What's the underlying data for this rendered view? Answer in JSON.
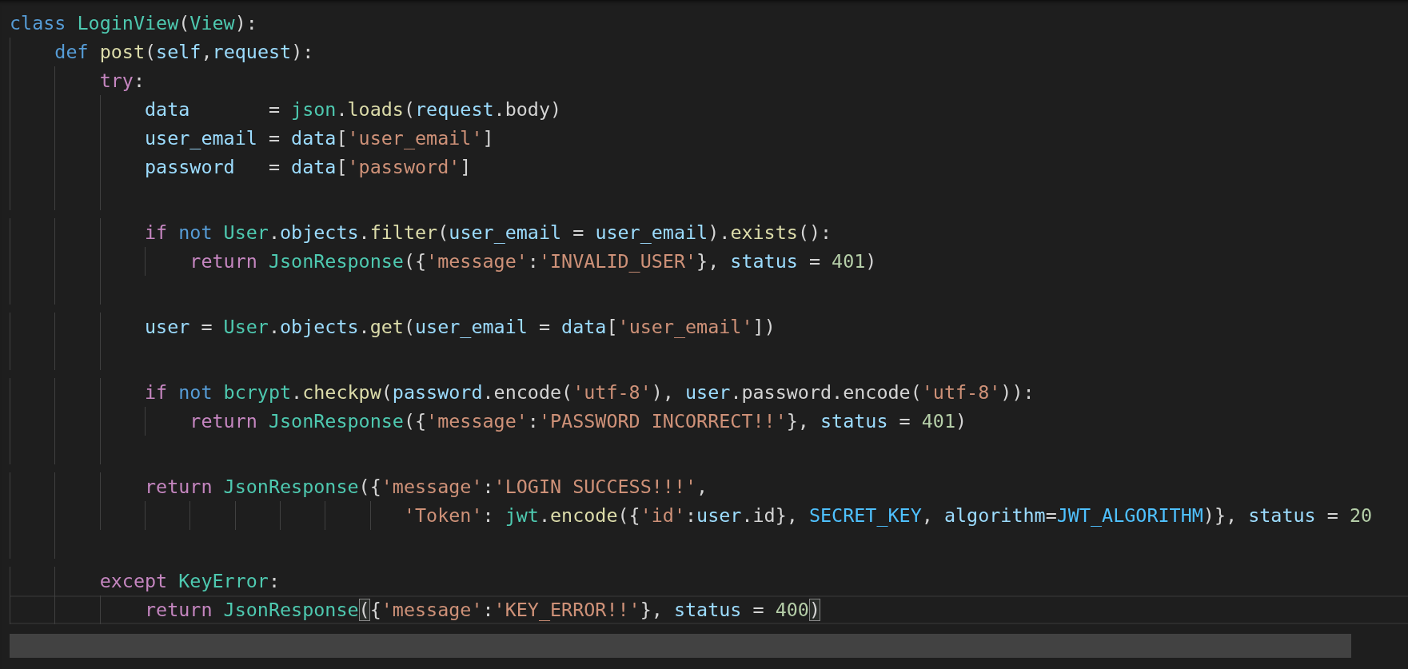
{
  "editor": {
    "lines": [
      {
        "kind": "code",
        "active": false,
        "tokens": [
          {
            "kind": "keyword",
            "text": "class "
          },
          {
            "kind": "type",
            "text": "LoginView"
          },
          {
            "kind": "plain",
            "text": "("
          },
          {
            "kind": "type",
            "text": "View"
          },
          {
            "kind": "plain",
            "text": "):"
          }
        ]
      },
      {
        "kind": "code",
        "active": false,
        "tokens": [
          {
            "kind": "keyword",
            "text": "    def "
          },
          {
            "kind": "function",
            "text": "post"
          },
          {
            "kind": "plain",
            "text": "("
          },
          {
            "kind": "variable",
            "text": "self"
          },
          {
            "kind": "plain",
            "text": ","
          },
          {
            "kind": "variable",
            "text": "request"
          },
          {
            "kind": "plain",
            "text": "):"
          }
        ]
      },
      {
        "kind": "code",
        "active": false,
        "tokens": [
          {
            "kind": "control",
            "text": "        try"
          },
          {
            "kind": "plain",
            "text": ":"
          }
        ]
      },
      {
        "kind": "code",
        "active": false,
        "tokens": [
          {
            "kind": "variable",
            "text": "            data"
          },
          {
            "kind": "plain",
            "text": "       = "
          },
          {
            "kind": "type",
            "text": "json"
          },
          {
            "kind": "plain",
            "text": "."
          },
          {
            "kind": "function",
            "text": "loads"
          },
          {
            "kind": "plain",
            "text": "("
          },
          {
            "kind": "variable",
            "text": "request"
          },
          {
            "kind": "plain",
            "text": ".body)"
          }
        ]
      },
      {
        "kind": "code",
        "active": false,
        "tokens": [
          {
            "kind": "variable",
            "text": "            user_email"
          },
          {
            "kind": "plain",
            "text": " = "
          },
          {
            "kind": "variable",
            "text": "data"
          },
          {
            "kind": "plain",
            "text": "["
          },
          {
            "kind": "string",
            "text": "'user_email'"
          },
          {
            "kind": "plain",
            "text": "]"
          }
        ]
      },
      {
        "kind": "code",
        "active": false,
        "tokens": [
          {
            "kind": "variable",
            "text": "            password"
          },
          {
            "kind": "plain",
            "text": "   = "
          },
          {
            "kind": "variable",
            "text": "data"
          },
          {
            "kind": "plain",
            "text": "["
          },
          {
            "kind": "string",
            "text": "'password'"
          },
          {
            "kind": "plain",
            "text": "]"
          }
        ]
      },
      {
        "kind": "blank"
      },
      {
        "kind": "code",
        "active": false,
        "tokens": [
          {
            "kind": "control",
            "text": "            if "
          },
          {
            "kind": "keyword",
            "text": "not "
          },
          {
            "kind": "type",
            "text": "User"
          },
          {
            "kind": "plain",
            "text": "."
          },
          {
            "kind": "variable",
            "text": "objects"
          },
          {
            "kind": "plain",
            "text": "."
          },
          {
            "kind": "function",
            "text": "filter"
          },
          {
            "kind": "plain",
            "text": "("
          },
          {
            "kind": "variable",
            "text": "user_email"
          },
          {
            "kind": "plain",
            "text": " = "
          },
          {
            "kind": "variable",
            "text": "user_email"
          },
          {
            "kind": "plain",
            "text": ")."
          },
          {
            "kind": "function",
            "text": "exists"
          },
          {
            "kind": "plain",
            "text": "():"
          }
        ]
      },
      {
        "kind": "code",
        "active": false,
        "tokens": [
          {
            "kind": "control",
            "text": "                return "
          },
          {
            "kind": "type",
            "text": "JsonResponse"
          },
          {
            "kind": "plain",
            "text": "({"
          },
          {
            "kind": "string",
            "text": "'message'"
          },
          {
            "kind": "plain",
            "text": ":"
          },
          {
            "kind": "string",
            "text": "'INVALID_USER'"
          },
          {
            "kind": "plain",
            "text": "}, "
          },
          {
            "kind": "variable",
            "text": "status"
          },
          {
            "kind": "plain",
            "text": " = "
          },
          {
            "kind": "number",
            "text": "401"
          },
          {
            "kind": "plain",
            "text": ")"
          }
        ]
      },
      {
        "kind": "blank"
      },
      {
        "kind": "code",
        "active": false,
        "tokens": [
          {
            "kind": "variable",
            "text": "            user"
          },
          {
            "kind": "plain",
            "text": " = "
          },
          {
            "kind": "type",
            "text": "User"
          },
          {
            "kind": "plain",
            "text": "."
          },
          {
            "kind": "variable",
            "text": "objects"
          },
          {
            "kind": "plain",
            "text": "."
          },
          {
            "kind": "function",
            "text": "get"
          },
          {
            "kind": "plain",
            "text": "("
          },
          {
            "kind": "variable",
            "text": "user_email"
          },
          {
            "kind": "plain",
            "text": " = "
          },
          {
            "kind": "variable",
            "text": "data"
          },
          {
            "kind": "plain",
            "text": "["
          },
          {
            "kind": "string",
            "text": "'user_email'"
          },
          {
            "kind": "plain",
            "text": "])"
          }
        ]
      },
      {
        "kind": "blank"
      },
      {
        "kind": "code",
        "active": false,
        "tokens": [
          {
            "kind": "control",
            "text": "            if "
          },
          {
            "kind": "keyword",
            "text": "not "
          },
          {
            "kind": "type",
            "text": "bcrypt"
          },
          {
            "kind": "plain",
            "text": "."
          },
          {
            "kind": "function",
            "text": "checkpw"
          },
          {
            "kind": "plain",
            "text": "("
          },
          {
            "kind": "variable",
            "text": "password"
          },
          {
            "kind": "plain",
            "text": ".encode("
          },
          {
            "kind": "string",
            "text": "'utf-8'"
          },
          {
            "kind": "plain",
            "text": "), "
          },
          {
            "kind": "variable",
            "text": "user"
          },
          {
            "kind": "plain",
            "text": ".password.encode("
          },
          {
            "kind": "string",
            "text": "'utf-8'"
          },
          {
            "kind": "plain",
            "text": ")):"
          }
        ]
      },
      {
        "kind": "code",
        "active": false,
        "tokens": [
          {
            "kind": "control",
            "text": "                return "
          },
          {
            "kind": "type",
            "text": "JsonResponse"
          },
          {
            "kind": "plain",
            "text": "({"
          },
          {
            "kind": "string",
            "text": "'message'"
          },
          {
            "kind": "plain",
            "text": ":"
          },
          {
            "kind": "string",
            "text": "'PASSWORD INCORRECT!!'"
          },
          {
            "kind": "plain",
            "text": "}, "
          },
          {
            "kind": "variable",
            "text": "status"
          },
          {
            "kind": "plain",
            "text": " = "
          },
          {
            "kind": "number",
            "text": "401"
          },
          {
            "kind": "plain",
            "text": ")"
          }
        ]
      },
      {
        "kind": "blank"
      },
      {
        "kind": "code",
        "active": false,
        "tokens": [
          {
            "kind": "control",
            "text": "            return "
          },
          {
            "kind": "type",
            "text": "JsonResponse"
          },
          {
            "kind": "plain",
            "text": "({"
          },
          {
            "kind": "string",
            "text": "'message'"
          },
          {
            "kind": "plain",
            "text": ":"
          },
          {
            "kind": "string",
            "text": "'LOGIN SUCCESS!!!'"
          },
          {
            "kind": "plain",
            "text": ","
          }
        ]
      },
      {
        "kind": "code",
        "active": false,
        "tokens": [
          {
            "kind": "string",
            "text": "                                   'Token'"
          },
          {
            "kind": "plain",
            "text": ": "
          },
          {
            "kind": "type",
            "text": "jwt"
          },
          {
            "kind": "plain",
            "text": "."
          },
          {
            "kind": "function",
            "text": "encode"
          },
          {
            "kind": "plain",
            "text": "({"
          },
          {
            "kind": "string",
            "text": "'id'"
          },
          {
            "kind": "plain",
            "text": ":"
          },
          {
            "kind": "variable",
            "text": "user"
          },
          {
            "kind": "plain",
            "text": ".id}, "
          },
          {
            "kind": "constant",
            "text": "SECRET_KEY"
          },
          {
            "kind": "plain",
            "text": ", "
          },
          {
            "kind": "variable",
            "text": "algorithm"
          },
          {
            "kind": "plain",
            "text": "="
          },
          {
            "kind": "constant",
            "text": "JWT_ALGORITHM"
          },
          {
            "kind": "plain",
            "text": ")}, "
          },
          {
            "kind": "variable",
            "text": "status"
          },
          {
            "kind": "plain",
            "text": " = "
          },
          {
            "kind": "number",
            "text": "20"
          }
        ]
      },
      {
        "kind": "blank"
      },
      {
        "kind": "code",
        "active": false,
        "tokens": [
          {
            "kind": "control",
            "text": "        except "
          },
          {
            "kind": "type",
            "text": "KeyError"
          },
          {
            "kind": "plain",
            "text": ":"
          }
        ]
      },
      {
        "kind": "code",
        "active": true,
        "tokens": [
          {
            "kind": "control",
            "text": "            return "
          },
          {
            "kind": "type",
            "text": "JsonResponse"
          },
          {
            "kind": "bracket",
            "text": "("
          },
          {
            "kind": "plain",
            "text": "{"
          },
          {
            "kind": "string",
            "text": "'message'"
          },
          {
            "kind": "plain",
            "text": ":"
          },
          {
            "kind": "string",
            "text": "'KEY_ERROR!!'"
          },
          {
            "kind": "plain",
            "text": "}, "
          },
          {
            "kind": "variable",
            "text": "status"
          },
          {
            "kind": "plain",
            "text": " = "
          },
          {
            "kind": "number",
            "text": "400"
          },
          {
            "kind": "bracket",
            "text": ")"
          }
        ]
      }
    ]
  }
}
